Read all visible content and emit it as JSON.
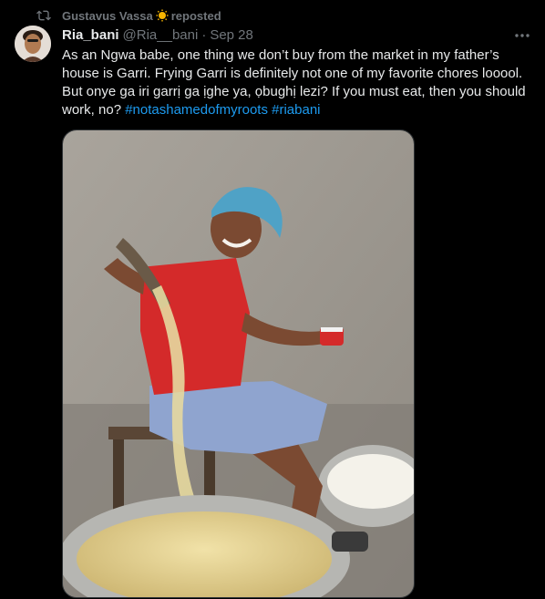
{
  "repost": {
    "user": "Gustavus Vassa",
    "label": "reposted",
    "icon": "repost-icon",
    "badge_icon": "sun-badge-icon"
  },
  "tweet": {
    "display_name": "Ria_bani",
    "handle": "@Ria__bani",
    "separator": "·",
    "date": "Sep 28",
    "text": "As an Ngwa babe, one thing we don’t buy from the market in my father’s house is Garri. Frying Garri is definitely not one of my favorite chores looool. But onye ga iri garrị ga ịghe ya, ọbughị lezi? If you must eat, then you should work, no? ",
    "hashtags": [
      "#notashamedofmyroots",
      "#riabani"
    ],
    "more_icon": "more-options-icon"
  },
  "media": {
    "icon": "photo-woman-sifting-garri"
  },
  "colors": {
    "background": "#000000",
    "text": "#e7e9ea",
    "secondary": "#71767b",
    "link": "#1d9bf0"
  }
}
